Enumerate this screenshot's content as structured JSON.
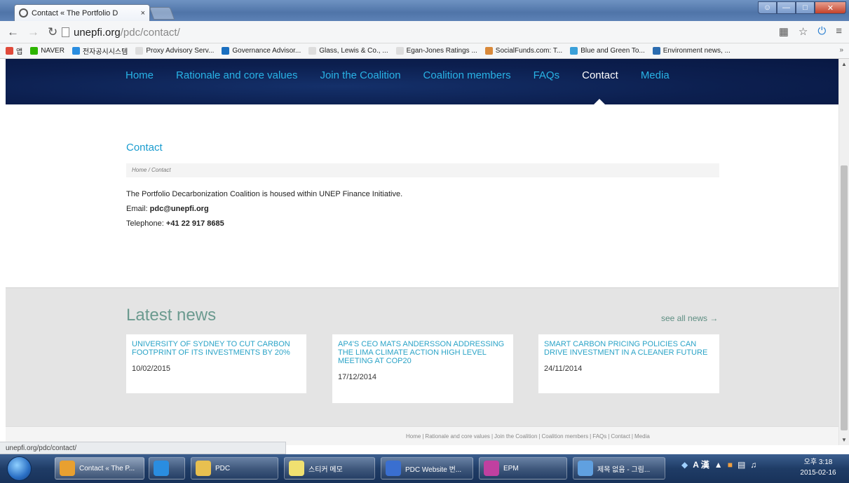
{
  "browser": {
    "tab_title": "Contact « The Portfolio D",
    "tab_close": "×",
    "url_host": "unepfi.org",
    "url_path": "/pdc/contact/",
    "status_url": "unepfi.org/pdc/contact/"
  },
  "bookmarks": [
    {
      "label": "앱",
      "color": "#e04a3a"
    },
    {
      "label": "NAVER",
      "color": "#2db400"
    },
    {
      "label": "전자공시시스템",
      "color": "#2a8de0"
    },
    {
      "label": "Proxy Advisory Serv...",
      "color": "#dddddd"
    },
    {
      "label": "Governance Advisor...",
      "color": "#1a6fc0"
    },
    {
      "label": "Glass, Lewis & Co., ...",
      "color": "#dddddd"
    },
    {
      "label": "Egan-Jones Ratings ...",
      "color": "#dddddd"
    },
    {
      "label": "SocialFunds.com: T...",
      "color": "#d9893a"
    },
    {
      "label": "Blue and Green To...",
      "color": "#3aa0d9"
    },
    {
      "label": "Environment news, ...",
      "color": "#2b6cb0"
    }
  ],
  "bookmarks_more": "»",
  "nav": {
    "items": [
      "Home",
      "Rationale and core values",
      "Join the Coalition",
      "Coalition members",
      "FAQs",
      "Contact",
      "Media"
    ],
    "active": "Contact"
  },
  "contact": {
    "title": "Contact",
    "breadcrumb": "Home  /  Contact",
    "intro": "The Portfolio Decarbonization Coalition is housed within UNEP Finance Initiative.",
    "email_label": "Email:",
    "email": "pdc@unepfi.org",
    "phone_label": "Telephone:",
    "phone": "+41 22 917 8685"
  },
  "news": {
    "title": "Latest news",
    "see_all": "see all news →",
    "items": [
      {
        "headline": "UNIVERSITY OF SYDNEY TO CUT CARBON FOOTPRINT OF ITS INVESTMENTS BY 20%",
        "date": "10/02/2015"
      },
      {
        "headline": "AP4'S CEO MATS ANDERSSON ADDRESSING THE LIMA CLIMATE ACTION HIGH LEVEL MEETING AT COP20",
        "date": "17/12/2014"
      },
      {
        "headline": "SMART CARBON PRICING POLICIES CAN DRIVE INVESTMENT IN A CLEANER FUTURE",
        "date": "24/11/2014"
      }
    ]
  },
  "footer": {
    "links": [
      "Home",
      "Rationale and core values",
      "Join the Coalition",
      "Coalition members",
      "FAQs",
      "Contact",
      "Media"
    ]
  },
  "taskbar": {
    "items": [
      {
        "label": "Contact « The P...",
        "color": "#e8a030"
      },
      {
        "label": "",
        "color": "#2a8de0"
      },
      {
        "label": "PDC",
        "color": "#e8c050"
      },
      {
        "label": "스티커 메모",
        "color": "#f0e070"
      },
      {
        "label": "PDC Website 번...",
        "color": "#3a6fd0"
      },
      {
        "label": "EPM",
        "color": "#c040a0"
      },
      {
        "label": "제목 없음 - 그림...",
        "color": "#60a0e0"
      }
    ],
    "tray_text": "A 漢",
    "time": "오후 3:18",
    "date": "2015-02-16"
  }
}
